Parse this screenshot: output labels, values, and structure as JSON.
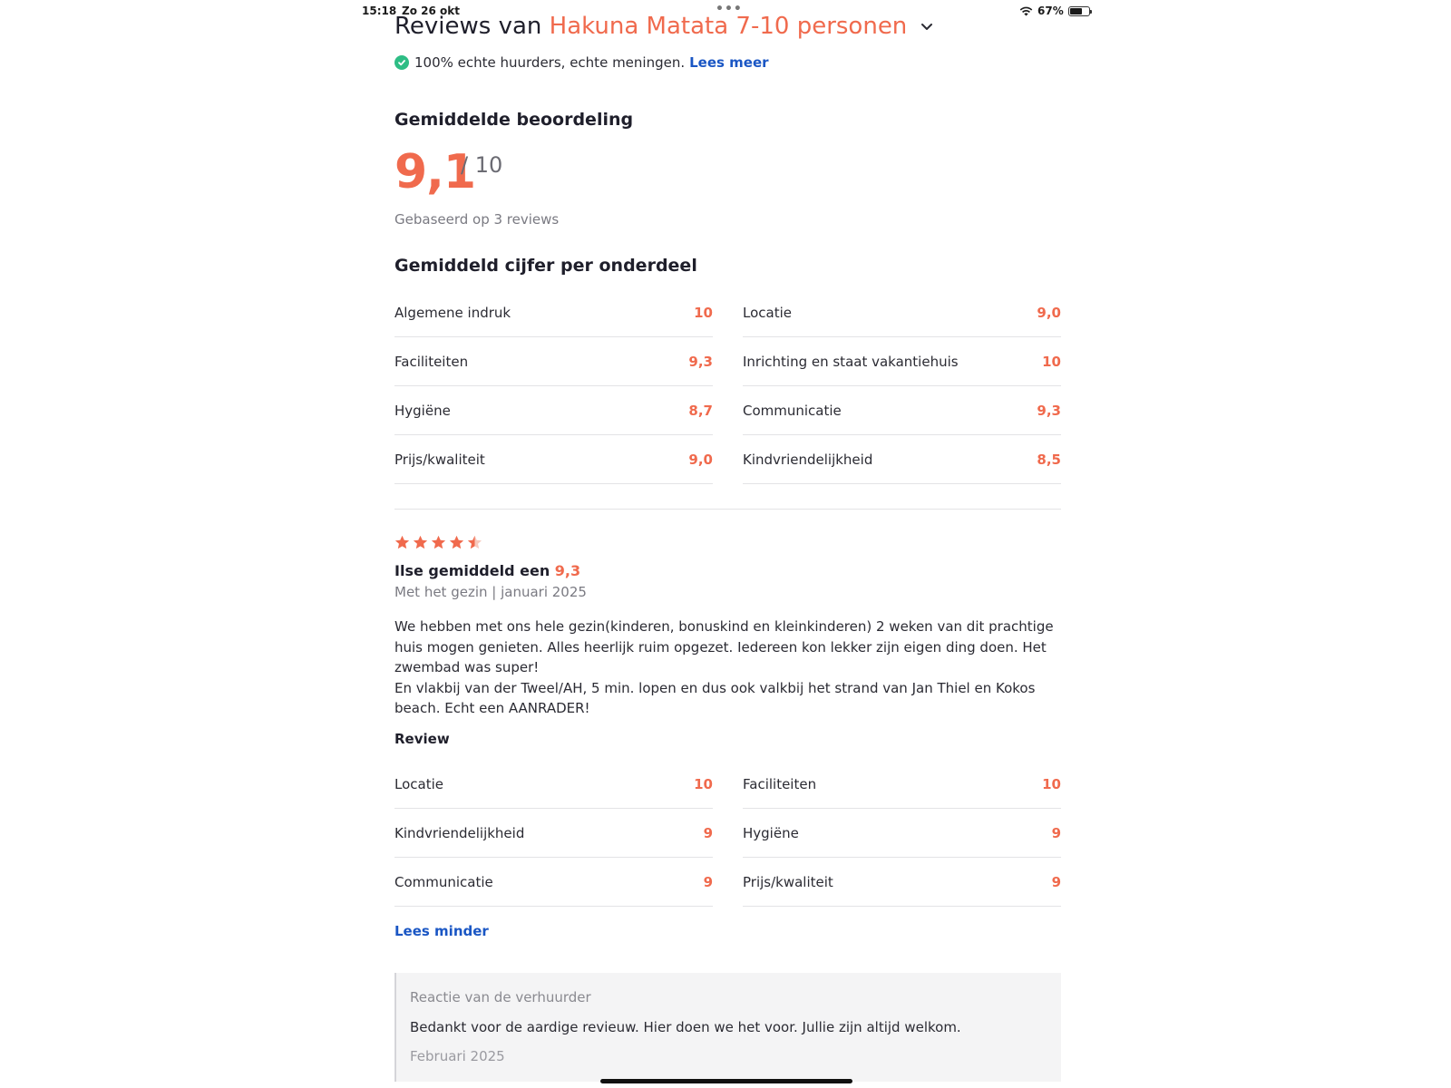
{
  "status_bar": {
    "time": "15:18",
    "date": "Zo 26 okt",
    "battery": "67%",
    "battery_level": 0.67
  },
  "header": {
    "title_prefix": "Reviews van",
    "title_name": "Hakuna Matata 7-10 personen"
  },
  "verified": {
    "text": "100% echte huurders, echte meningen.",
    "link": "Lees meer"
  },
  "average": {
    "heading": "Gemiddelde beoordeling",
    "score": "9,1",
    "max": "/ 10",
    "based_on": "Gebaseerd op 3 reviews"
  },
  "per_category": {
    "heading": "Gemiddeld cijfer per onderdeel",
    "left": [
      {
        "label": "Algemene indruk",
        "value": "10"
      },
      {
        "label": "Faciliteiten",
        "value": "9,3"
      },
      {
        "label": "Hygiëne",
        "value": "8,7"
      },
      {
        "label": "Prijs/kwaliteit",
        "value": "9,0"
      }
    ],
    "right": [
      {
        "label": "Locatie",
        "value": "9,0"
      },
      {
        "label": "Inrichting en staat vakantiehuis",
        "value": "10"
      },
      {
        "label": "Communicatie",
        "value": "9,3"
      },
      {
        "label": "Kindvriendelijkheid",
        "value": "8,5"
      }
    ]
  },
  "review": {
    "stars": 4.5,
    "reviewer_prefix": "Ilse gemiddeld een",
    "reviewer_score": "9,3",
    "meta": "Met het gezin | januari 2025",
    "text_p1": "We hebben met ons hele gezin(kinderen, bonuskind en kleinkinderen) 2 weken van dit prachtige huis mogen genieten. Alles heerlijk ruim opgezet. Iedereen kon lekker zijn eigen ding doen. Het zwembad was super!",
    "text_p2": "En vlakbij van der Tweel/AH, 5 min. lopen en dus ook valkbij het strand van Jan Thiel en Kokos beach. Echt een AANRADER!",
    "label": "Review",
    "left": [
      {
        "label": "Locatie",
        "value": "10"
      },
      {
        "label": "Kindvriendelijkheid",
        "value": "9"
      },
      {
        "label": "Communicatie",
        "value": "9"
      }
    ],
    "right": [
      {
        "label": "Faciliteiten",
        "value": "10"
      },
      {
        "label": "Hygiëne",
        "value": "9"
      },
      {
        "label": "Prijs/kwaliteit",
        "value": "9"
      }
    ],
    "read_less": "Lees minder"
  },
  "owner_reply": {
    "title": "Reactie van de verhuurder",
    "text": "Bedankt voor de aardige revieuw. Hier doen we het voor. Jullie zijn altijd welkom.",
    "date": "Februari 2025"
  },
  "colors": {
    "accent": "#f06a4d",
    "link": "#1a56c4",
    "check": "#2ebd85"
  }
}
